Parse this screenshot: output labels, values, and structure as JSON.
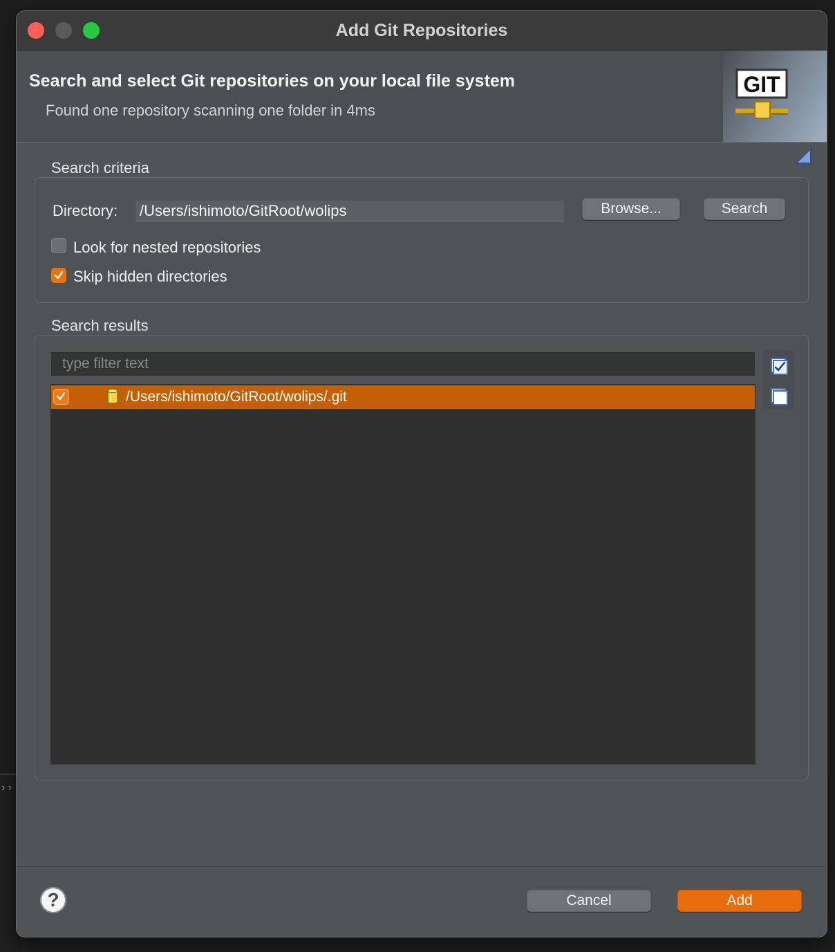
{
  "window": {
    "title": "Add Git Repositories"
  },
  "banner": {
    "title": "Search and select Git repositories on your local file system",
    "subtitle": "Found one repository scanning one folder in 4ms",
    "logo_text": "GIT"
  },
  "criteria": {
    "group_label": "Search criteria",
    "directory_label": "Directory:",
    "directory_value": "/Users/ishimoto/GitRoot/wolips",
    "browse_label": "Browse...",
    "search_label": "Search",
    "nested": {
      "label": "Look for nested repositories",
      "checked": false
    },
    "skip_hidden": {
      "label": "Skip hidden directories",
      "checked": true
    }
  },
  "results": {
    "group_label": "Search results",
    "filter_placeholder": "type filter text",
    "items": [
      {
        "path": "/Users/ishimoto/GitRoot/wolips/.git",
        "checked": true,
        "selected": true,
        "icon": "repository-icon"
      }
    ],
    "tools": [
      "select-all-icon",
      "deselect-all-icon"
    ]
  },
  "footer": {
    "help_symbol": "?",
    "cancel_label": "Cancel",
    "add_label": "Add"
  },
  "colors": {
    "accent": "#e96d0c",
    "selection": "#c55f04",
    "dialog_bg": "#505457",
    "list_bg": "#2f2f2f"
  }
}
